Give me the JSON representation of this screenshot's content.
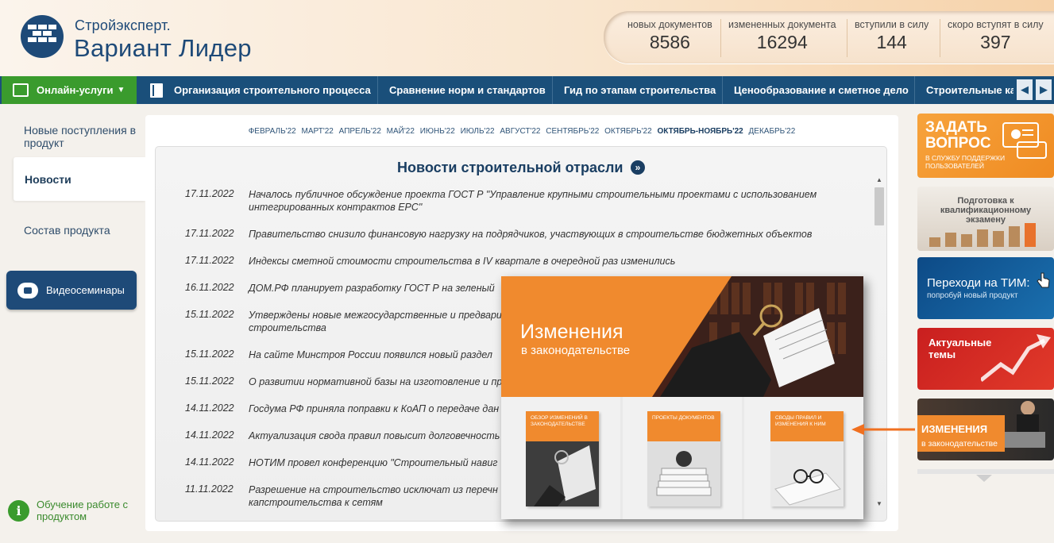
{
  "header": {
    "logo_line1": "Стройэксперт.",
    "logo_line2": "Вариант Лидер",
    "stats": [
      {
        "label": "новых документов",
        "value": "8586"
      },
      {
        "label": "измененных документа",
        "value": "16294"
      },
      {
        "label": "вступили в силу",
        "value": "144"
      },
      {
        "label": "скоро вступят в силу",
        "value": "397"
      }
    ]
  },
  "nav": {
    "online_label": "Онлайн-услуги",
    "items": [
      "Организация строительного процесса",
      "Сравнение норм и стандартов",
      "Гид по этапам строительства",
      "Ценообразование и сметное дело",
      "Строительные ка"
    ],
    "prev_arrow": "◀",
    "next_arrow": "▶"
  },
  "sidebar": {
    "item_new": "Новые поступления в продукт",
    "item_news": "Новости",
    "item_contents": "Состав продукта",
    "video_label": "Видеосеминары",
    "learn_label": "Обучение работе с продуктом",
    "learn_icon": "i"
  },
  "months": [
    "ФЕВРАЛЬ'22",
    "МАРТ'22",
    "АПРЕЛЬ'22",
    "МАЙ'22",
    "ИЮНЬ'22",
    "ИЮЛЬ'22",
    "АВГУСТ'22",
    "СЕНТЯБРЬ'22",
    "ОКТЯБРЬ'22",
    "ОКТЯБРЬ-НОЯБРЬ'22",
    "ДЕКАБРЬ'22"
  ],
  "news": {
    "title": "Новости строительной отрасли",
    "title_icon": "»",
    "items": [
      {
        "date": "17.11.2022",
        "text": "Началось публичное обсуждение проекта ГОСТ Р \"Управление крупными строительными проектами с использованием интегрированных контрактов EPC\""
      },
      {
        "date": "17.11.2022",
        "text": "Правительство снизило финансовую нагрузку на подрядчиков, участвующих в строительстве бюджетных объектов"
      },
      {
        "date": "17.11.2022",
        "text": "Индексы сметной стоимости строительства в IV квартале в очередной раз изменились"
      },
      {
        "date": "16.11.2022",
        "text": "ДОМ.РФ планирует разработку ГОСТ Р на зеленый"
      },
      {
        "date": "15.11.2022",
        "text": "Утверждены новые межгосударственные и предвари строительства"
      },
      {
        "date": "15.11.2022",
        "text": "На сайте Минстроя России появился новый раздел"
      },
      {
        "date": "15.11.2022",
        "text": "О развитии нормативной базы на изготовление и пр"
      },
      {
        "date": "14.11.2022",
        "text": "Госдума РФ приняла поправки к КоАП о передаче дан"
      },
      {
        "date": "14.11.2022",
        "text": "Актуализация свода правил повысит долговечность"
      },
      {
        "date": "14.11.2022",
        "text": "НОТИМ провел конференцию \"Строительный навиг"
      },
      {
        "date": "11.11.2022",
        "text": "Разрешение на строительство исключат из перечн капстроительства к сетям"
      }
    ]
  },
  "popup": {
    "title": "Изменения",
    "subtitle": "в законодательстве",
    "cards": [
      "ОБЗОР ИЗМЕНЕНИЙ В ЗАКОНОДАТЕЛЬСТВЕ",
      "ПРОЕКТЫ ДОКУМЕНТОВ",
      "СВОДЫ ПРАВИЛ И ИЗМЕНЕНИЯ К НИМ"
    ]
  },
  "right_banners": {
    "ask_title": "ЗАДАТЬ ВОПРОС",
    "ask_sub": "В СЛУЖБУ ПОДДЕРЖКИ ПОЛЬЗОВАТЕЛЕЙ",
    "exam": "Подготовка к квалификационному экзамену",
    "tim_title": "Переходи на ТИМ:",
    "tim_sub": "попробуй новый продукт",
    "topics": "Актуальные темы",
    "law_title": "ИЗМЕНЕНИЯ",
    "law_sub": "в законодательстве"
  },
  "colors": {
    "brand_blue": "#1a4f7a",
    "online_green": "#3a9b2d",
    "accent_orange": "#f08a2e"
  }
}
